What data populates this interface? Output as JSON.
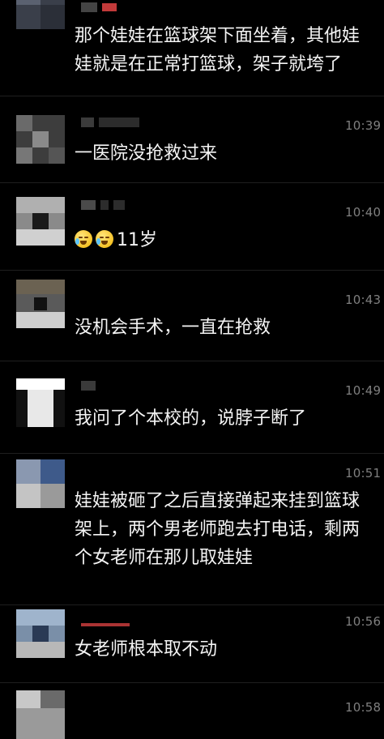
{
  "messages": [
    {
      "time": "",
      "lines": [
        "那个娃娃在篮球架下面坐着，其他娃",
        "娃就是在正常打篮球，架子就垮了"
      ]
    },
    {
      "time": "10:39",
      "lines": [
        "一医院没抢救过来"
      ]
    },
    {
      "time": "10:40",
      "emoji": [
        "crying-emoji",
        "crying-emoji"
      ],
      "lines": [
        "11岁"
      ]
    },
    {
      "time": "10:43",
      "lines": [
        "没机会手术，一直在抢救"
      ]
    },
    {
      "time": "10:49",
      "lines": [
        "我问了个本校的，说脖子断了"
      ]
    },
    {
      "time": "10:51",
      "lines": [
        "娃娃被砸了之后直接弹起来挂到篮球",
        "架上，两个男老师跑去打电话，剩两",
        "个女老师在那儿取娃娃"
      ]
    },
    {
      "time": "10:56",
      "lines": [
        "女老师根本取不动"
      ]
    },
    {
      "time": "10:58",
      "lines": []
    }
  ],
  "colors": {
    "background": "#000000",
    "text": "#f4f4f4",
    "timestamp": "#7f7f7f",
    "divider": "#1f1f1f"
  }
}
